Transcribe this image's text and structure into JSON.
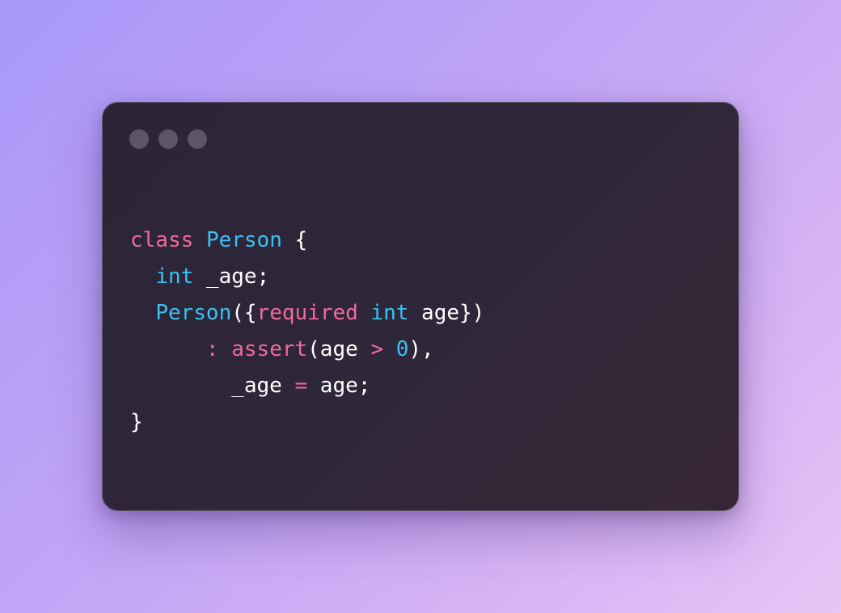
{
  "window": {
    "traffic_lights": [
      "dot",
      "dot",
      "dot"
    ]
  },
  "colors": {
    "keyword": "#f06a9f",
    "type": "#39c2f4",
    "plain": "#ffffff",
    "window_bg": "#2d2638",
    "dot": "#5b5566"
  },
  "code": {
    "language": "dart",
    "lines": [
      [
        {
          "t": "class",
          "k": "keyword"
        },
        {
          "t": " ",
          "k": "plain"
        },
        {
          "t": "Person",
          "k": "type"
        },
        {
          "t": " {",
          "k": "plain"
        }
      ],
      [
        {
          "t": "  ",
          "k": "plain"
        },
        {
          "t": "int",
          "k": "type"
        },
        {
          "t": " _age;",
          "k": "plain"
        }
      ],
      [
        {
          "t": "  ",
          "k": "plain"
        },
        {
          "t": "Person",
          "k": "type"
        },
        {
          "t": "({",
          "k": "plain"
        },
        {
          "t": "required",
          "k": "keyword"
        },
        {
          "t": " ",
          "k": "plain"
        },
        {
          "t": "int",
          "k": "type"
        },
        {
          "t": " age})",
          "k": "plain"
        }
      ],
      [
        {
          "t": "      ",
          "k": "plain"
        },
        {
          "t": ":",
          "k": "keyword"
        },
        {
          "t": " ",
          "k": "plain"
        },
        {
          "t": "assert",
          "k": "keyword"
        },
        {
          "t": "(age ",
          "k": "plain"
        },
        {
          "t": ">",
          "k": "keyword"
        },
        {
          "t": " ",
          "k": "plain"
        },
        {
          "t": "0",
          "k": "type"
        },
        {
          "t": "),",
          "k": "plain"
        }
      ],
      [
        {
          "t": "        _age ",
          "k": "plain"
        },
        {
          "t": "=",
          "k": "keyword"
        },
        {
          "t": " age;",
          "k": "plain"
        }
      ],
      [
        {
          "t": "}",
          "k": "plain"
        }
      ]
    ]
  }
}
